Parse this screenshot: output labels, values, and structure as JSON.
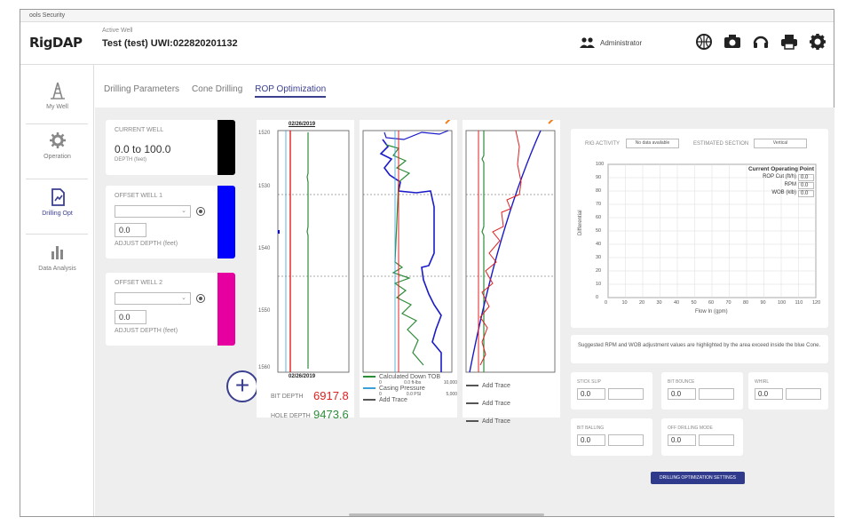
{
  "topbar": {
    "text": "ools   Security"
  },
  "header": {
    "logo": "RigDAP",
    "active_label": "Active Well",
    "active_well": "Test (test) UWI:022820201132",
    "user": "Administrator"
  },
  "sidebar": {
    "items": [
      {
        "label": "My Well"
      },
      {
        "label": "Operation"
      },
      {
        "label": "Drilling Opt"
      },
      {
        "label": "Data Analysis"
      }
    ]
  },
  "tabs": [
    {
      "label": "Drilling Parameters"
    },
    {
      "label": "Cone Drilling"
    },
    {
      "label": "ROP Optimization"
    }
  ],
  "wells": {
    "current": {
      "title": "CURRENT WELL",
      "value": "0.0 to 100.0",
      "sub": "DEPTH (feet)",
      "color": "#000000"
    },
    "offset1": {
      "title": "OFFSET WELL 1",
      "depth": "0.0",
      "adjust": "ADJUST DEPTH (feet)",
      "color": "#0000ff"
    },
    "offset2": {
      "title": "OFFSET WELL 2",
      "depth": "0.0",
      "adjust": "ADJUST DEPTH (feet)",
      "color": "#e600a0"
    },
    "add_symbol": "+"
  },
  "tracks": {
    "date_top": "02/26/2019",
    "date_bottom": "02/26/2019",
    "depth_ticks": [
      "1520",
      "1530",
      "1540",
      "1550",
      "1560"
    ],
    "bit_depth_label": "BIT DEPTH",
    "bit_depth_value": "6917.8",
    "hole_depth_label": "HOLE DEPTH",
    "hole_depth_value": "9473.6",
    "track2_legend": [
      {
        "name": "Calculated Down TOB",
        "range_min": "0",
        "range_mid": "0.0 ft-lbs",
        "range_max": "10,000",
        "color": "#2e8b3a"
      },
      {
        "name": "Casing Pressure",
        "range_min": "0",
        "range_mid": "0.0 PSI",
        "range_max": "5,000",
        "color": "#3aa0d8"
      },
      {
        "name": "Add Trace",
        "color": "#555555"
      }
    ],
    "track3_legend": [
      "Add Trace",
      "Add Trace",
      "Add Trace"
    ]
  },
  "right": {
    "rig_activity_label": "RIG ACTIVITY",
    "rig_activity_value": "No data available",
    "section_label": "ESTIMATED SECTION",
    "section_value": "Vertical",
    "cop_title": "Current Operating Point",
    "cop_rows": [
      {
        "label": "ROP Cut (ft/h)",
        "value": "0.0"
      },
      {
        "label": "RPM",
        "value": "0.0"
      },
      {
        "label": "WOB (klb)",
        "value": "0.0"
      }
    ],
    "xlabel": "Flow In (gpm)",
    "ylabel": "Differential",
    "xticks": [
      "0",
      "10",
      "20",
      "30",
      "40",
      "50",
      "60",
      "70",
      "80",
      "90",
      "100",
      "110",
      "120"
    ],
    "yticks": [
      "100",
      "90",
      "80",
      "70",
      "60",
      "50",
      "40",
      "30",
      "20",
      "10",
      "0"
    ],
    "note": "Suggested RPM and WOB adjustment values are highlighted by the area exceed inside the blue Cone.",
    "metrics": [
      {
        "label": "STICK SLIP",
        "value": "0.0"
      },
      {
        "label": "BIT BOUNCE",
        "value": "0.0"
      },
      {
        "label": "WHIRL",
        "value": "0.0"
      },
      {
        "label": "BIT BALLING",
        "value": "0.0"
      },
      {
        "label": "OFF DRILLING MODE",
        "value": "0.0"
      }
    ],
    "settings_button": "DRILLING OPTIMIZATION SETTINGS"
  }
}
